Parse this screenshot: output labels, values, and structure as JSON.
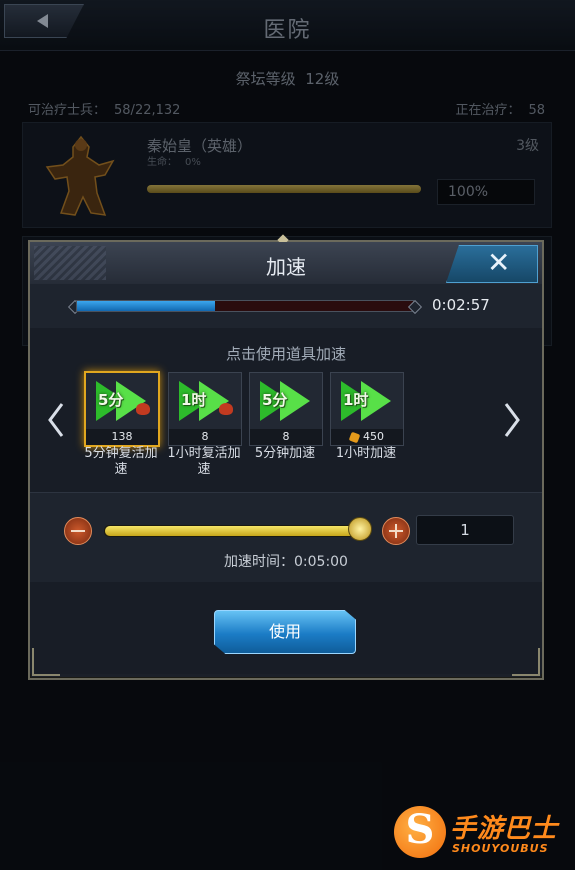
{
  "header": {
    "title": "医院",
    "back_icon": "back-arrow-icon"
  },
  "altar": {
    "label": "祭坛等级",
    "level": "12级"
  },
  "stats": {
    "healable_label": "可治疗士兵：",
    "healable_value": "58/22,132",
    "healing_label": "正在治疗：",
    "healing_value": "58"
  },
  "hero": {
    "name": "秦始皇（英雄）",
    "level": "3级",
    "life_label": "生命：",
    "life_value": "0%",
    "progress_text": "100%",
    "progress": 1.0
  },
  "dialog": {
    "title": "加速",
    "close_icon": "close-icon",
    "remaining_time": "0:02:57",
    "time_progress": 0.41,
    "hint": "点击使用道具加速",
    "items": [
      {
        "badge": "5分",
        "count": "138",
        "label": "5分钟复活加速",
        "selected": true,
        "icon": "speedup-arrow-icon"
      },
      {
        "badge": "1时",
        "count": "8",
        "label": "1小时复活加速",
        "selected": false,
        "icon": "speedup-arrow-icon"
      },
      {
        "badge": "5分",
        "count": "8",
        "label": "5分钟加速",
        "selected": false,
        "icon": "speedup-arrow-icon"
      },
      {
        "badge": "1时",
        "count": "450",
        "label": "1小时加速",
        "selected": false,
        "icon": "speedup-arrow-icon",
        "cost_icon": "gold-icon"
      }
    ],
    "slider_value": 1.0,
    "quantity": "1",
    "speed_time_label": "加速时间：0:05:00",
    "use_label": "使用"
  },
  "watermark": {
    "text": "手游巴士",
    "sub": "SHOUYOUBUS"
  },
  "colors": {
    "accent_gold": "#e1a71f",
    "accent_blue": "#1b7cc6",
    "bar_blue": "#3ba6ee"
  }
}
